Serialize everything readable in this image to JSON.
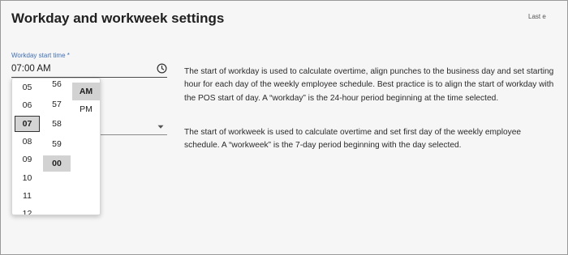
{
  "page": {
    "title": "Workday and workweek settings",
    "last_edited": "Last e"
  },
  "workday": {
    "label": "Workday start time *",
    "value": "07:00  AM",
    "icon": "clock-icon"
  },
  "picker": {
    "hours": [
      "05",
      "06",
      "07",
      "08",
      "09",
      "10",
      "11",
      "12"
    ],
    "selected_hour": "07",
    "minutes": [
      "56",
      "57",
      "58",
      "59",
      "00"
    ],
    "selected_minute": "00",
    "periods": [
      "AM",
      "PM"
    ],
    "selected_period": "AM"
  },
  "workweek": {
    "dropdown_icon": "chevron-down-icon"
  },
  "descriptions": {
    "workday": "The start of workday is used to calculate overtime, align punches to the business day and set starting hour for each day of the weekly employee schedule. Best practice is to align the start of workday with the POS start of day. A “workday” is the 24-hour period beginning at the time selected.",
    "workweek": "The start of workweek is used to calculate overtime and set first day of the weekly employee schedule. A “workweek” is the 7-day period beginning with the day selected."
  }
}
